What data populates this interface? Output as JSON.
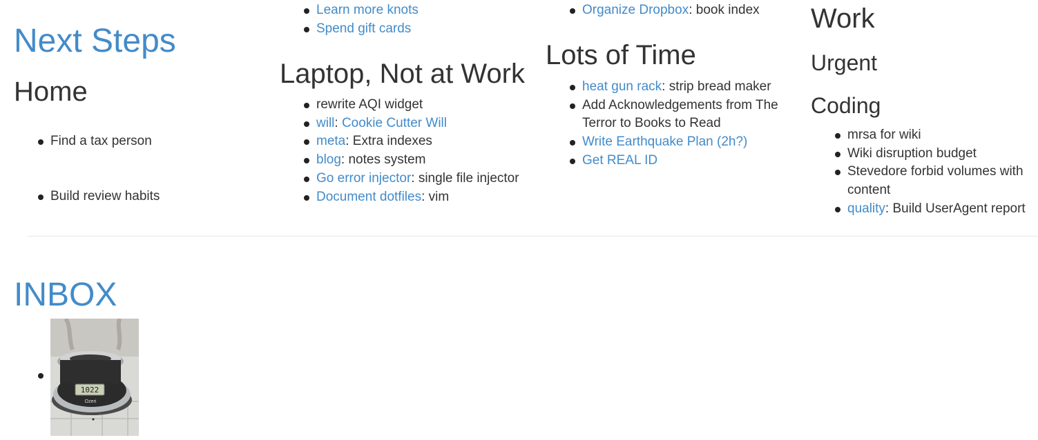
{
  "next_steps": {
    "title": "Next Steps",
    "home": {
      "title": "Home",
      "items": [
        "Find a tax person",
        "Build review habits"
      ]
    },
    "misc_items": [
      {
        "link": "Learn more knots"
      },
      {
        "link": "Spend gift cards"
      }
    ],
    "laptop": {
      "title": "Laptop, Not at Work",
      "items": [
        {
          "text": "rewrite AQI widget"
        },
        {
          "link": "will",
          "sep": ": ",
          "link2": "Cookie Cutter Will"
        },
        {
          "link": "meta",
          "text": ": Extra indexes"
        },
        {
          "link": "blog",
          "text": ": notes system"
        },
        {
          "link": "Go error injector",
          "text": ": single file injector"
        },
        {
          "link": "Document dotfiles",
          "text": ": vim"
        }
      ]
    },
    "dropbox_item": {
      "link": "Organize Dropbox",
      "text": ": book index"
    },
    "lots_of_time": {
      "title": "Lots of Time",
      "items": [
        {
          "link": "heat gun rack",
          "text": ": strip bread maker"
        },
        {
          "text": "Add Acknowledgements from The Terror to Books to Read"
        },
        {
          "link": "Write Earthquake Plan (2h?)"
        },
        {
          "link": "Get REAL ID"
        }
      ]
    },
    "work": {
      "title": "Work",
      "urgent_title": "Urgent",
      "coding_title": "Coding",
      "coding_items": [
        {
          "text": "mrsa for wiki"
        },
        {
          "text": "Wiki disruption budget"
        },
        {
          "text": "Stevedore forbid volumes with content"
        },
        {
          "link": "quality",
          "text": ": Build UserAgent report"
        }
      ]
    }
  },
  "inbox": {
    "title": "INBOX",
    "scale_brand": "Ozeri",
    "scale_display": "1022"
  },
  "colors": {
    "link": "#428bca",
    "text": "#333333",
    "divider": "#e6e6e6"
  }
}
